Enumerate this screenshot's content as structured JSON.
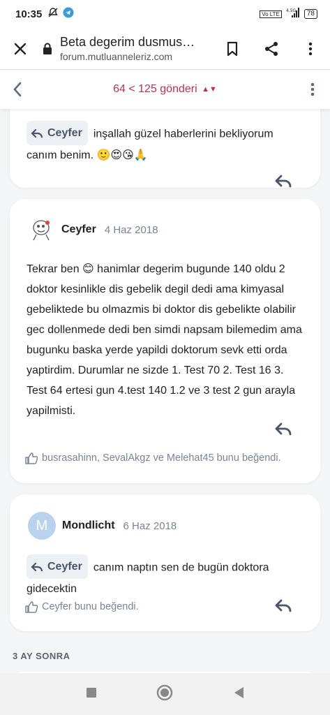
{
  "status_bar": {
    "time": "10:35",
    "network_top": "4.5G",
    "volte": "Vo LTE",
    "battery": "78"
  },
  "browser": {
    "page_title": "Beta degerim dusmus…",
    "url": "forum.mutluanneleriz.com"
  },
  "thread_nav": {
    "page_indicator": "64 < 125 gönderi"
  },
  "posts": [
    {
      "quote_author": "Ceyfer",
      "text": "inşallah güzel haberlerini bekliyorum canım benim. 🙂😍😘🙏"
    },
    {
      "author": "Ceyfer",
      "date": "4 Haz 2018",
      "text": "Tekrar ben 😊 hanimlar degerim bugunde 140 oldu 2 doktor kesinlikle dis gebelik degil dedi ama kimyasal gebeliktede bu olmazmis bi doktor dis gebelikte olabilir gec dollenmede dedi ben simdi napsam bilemedim ama bugunku baska yerde yapildi doktorum sevk etti orda yaptirdim. Durumlar ne sizde 1. Test 70 2. Test 16 3. Test 64 ertesi gun 4.test 140 1.2 ve 3 test 2 gun arayla yapilmisti.",
      "likes": "busrasahinn, SevalAkgz ve Melehat45 bunu beğendi."
    },
    {
      "author": "Mondlicht",
      "avatar_letter": "M",
      "date": "6 Haz 2018",
      "quote_author": "Ceyfer",
      "text": "canım naptın sen de bugün doktora gidecektin",
      "likes": "Ceyfer bunu beğendi."
    }
  ],
  "separator": "3 AY SONRA",
  "colors": {
    "accent": "#b8324f",
    "chip_bg": "#edf0f5",
    "muted": "#7a8494",
    "avatar_m": "#b9d3ef"
  }
}
